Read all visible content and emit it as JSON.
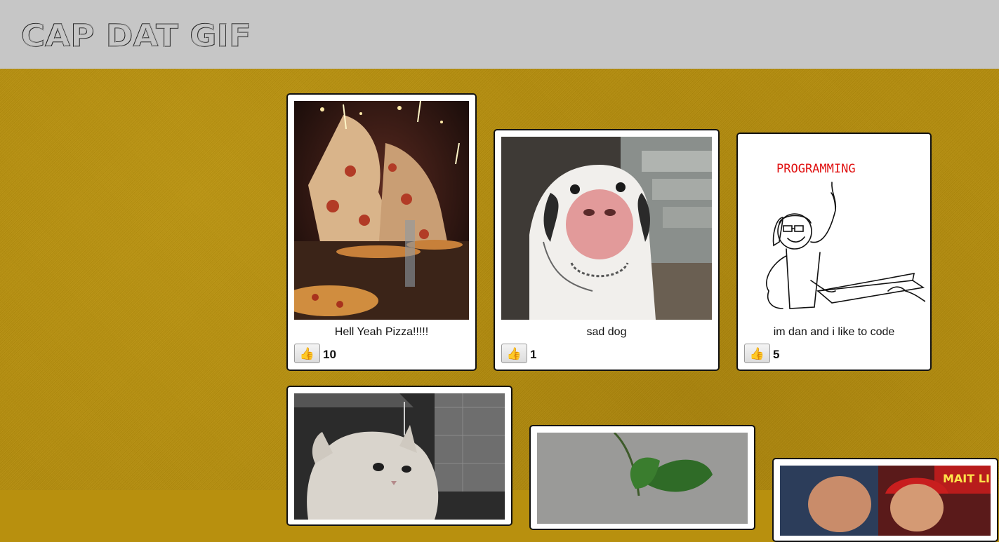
{
  "app": {
    "title": "CAP DAT GIF"
  },
  "cards": [
    {
      "caption": "Hell Yeah Pizza!!!!!",
      "likes": "10",
      "gif": "pizza-party-gif"
    },
    {
      "caption": "sad dog",
      "likes": "1",
      "gif": "sad-dog-gif"
    },
    {
      "caption": "im dan and i like to code",
      "likes": "5",
      "gif": "programming-stick-figure-gif",
      "gif_text": "PROGRAMMING"
    },
    {
      "gif": "wet-cat-gif"
    },
    {
      "gif": "plant-gif"
    },
    {
      "gif": "sports-fans-gif",
      "gif_text": "MAIT LI"
    }
  ],
  "icons": {
    "like": "thumbs-up-icon"
  },
  "colors": {
    "header": "#c6c6c6",
    "background": "#b48c0c",
    "card_border": "#111111"
  }
}
